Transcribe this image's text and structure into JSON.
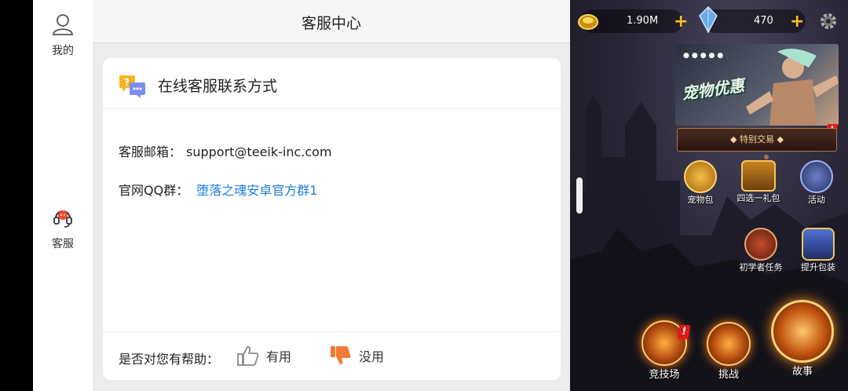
{
  "sidebar": {
    "items": [
      {
        "label": "我的",
        "icon": "user-icon"
      },
      {
        "label": "客服",
        "icon": "headset-icon"
      }
    ]
  },
  "header": {
    "title": "客服中心"
  },
  "contact": {
    "section_title": "在线客服联系方式",
    "section_icon": "chat-question-icon",
    "email_label": "客服邮箱：",
    "email_value": "support@teeik-inc.com",
    "qq_label": "官网QQ群：",
    "qq_value": "堕落之魂安卓官方群1"
  },
  "feedback": {
    "question": "是否对您有帮助：",
    "useful_label": "有用",
    "useless_label": "没用"
  },
  "game": {
    "gold": "1.90M",
    "gems": "470",
    "banner_title": "宠物优惠",
    "deal_label": "◆ 特别交易 ◆",
    "icons": [
      {
        "label": "宠物包"
      },
      {
        "label": "四选一礼包"
      },
      {
        "label": "活动"
      },
      {
        "label": "初学者任务"
      },
      {
        "label": "提升包装"
      },
      {
        "label": "竞技场"
      },
      {
        "label": "挑战"
      },
      {
        "label": "故事"
      }
    ],
    "colors": {
      "accent": "#ffc21a",
      "alert": "#e01818",
      "link": "#1e7ee0"
    }
  }
}
